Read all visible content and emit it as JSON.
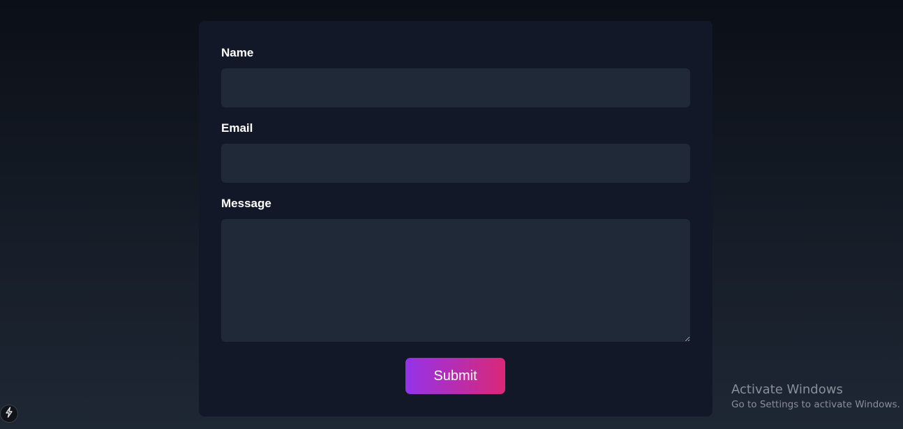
{
  "form": {
    "name_label": "Name",
    "name_value": "",
    "email_label": "Email",
    "email_value": "",
    "message_label": "Message",
    "message_value": "",
    "submit_label": "Submit"
  },
  "watermark": {
    "title": "Activate Windows",
    "subtitle": "Go to Settings to activate Windows."
  },
  "badge": {
    "icon": "lightning-icon"
  },
  "colors": {
    "background": "#111827",
    "card": "#121827",
    "input": "#1f2937",
    "button_gradient_start": "#9333ea",
    "button_gradient_end": "#db2777"
  }
}
